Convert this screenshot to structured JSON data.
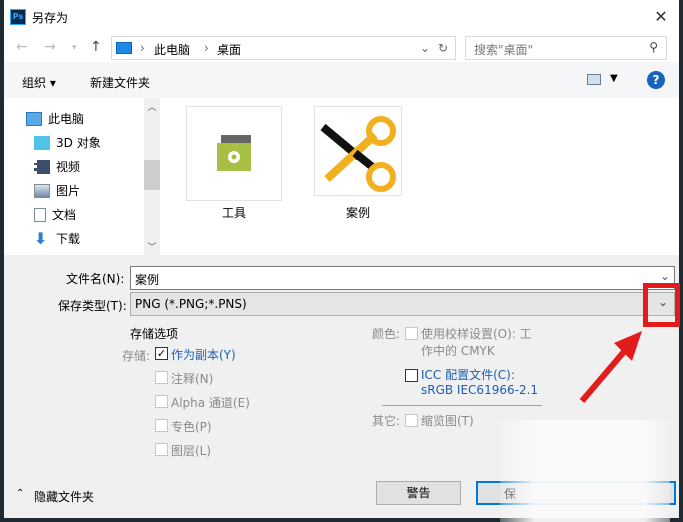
{
  "title": "另存为",
  "nav": {
    "path": [
      "此电脑",
      "桌面"
    ],
    "search_placeholder": "搜索\"桌面\""
  },
  "toolbar": {
    "organize": "组织 ▾",
    "new_folder": "新建文件夹",
    "help": "?"
  },
  "tree": [
    {
      "label": "此电脑"
    },
    {
      "label": "3D 对象"
    },
    {
      "label": "视频"
    },
    {
      "label": "图片"
    },
    {
      "label": "文档"
    },
    {
      "label": "下载"
    }
  ],
  "files": [
    {
      "name": "工具"
    },
    {
      "name": "案例"
    }
  ],
  "form": {
    "filename_label": "文件名(N):",
    "filename": "案例",
    "type_label": "保存类型(T):",
    "type": "PNG (*.PNG;*.PNS)"
  },
  "options": {
    "heading": "存储选项",
    "store_label": "存储:",
    "as_copy": "作为副本(Y)",
    "notes": "注释(N)",
    "alpha": "Alpha 通道(E)",
    "spot": "专色(P)",
    "layers": "图层(L)",
    "color_label": "颜色:",
    "proof": "使用校样设置(O): 工",
    "proof2": "作中的 CMYK",
    "icc": "ICC 配置文件(C):",
    "icc2": "sRGB IEC61966-2.1",
    "other_label": "其它:",
    "thumbnail": "缩览图(T)"
  },
  "footer": {
    "hide_folders": "隐藏文件夹",
    "warning": "警告",
    "save": "保"
  },
  "colors": {
    "highlight": "#e31b1b",
    "link": "#1a5fb4"
  }
}
